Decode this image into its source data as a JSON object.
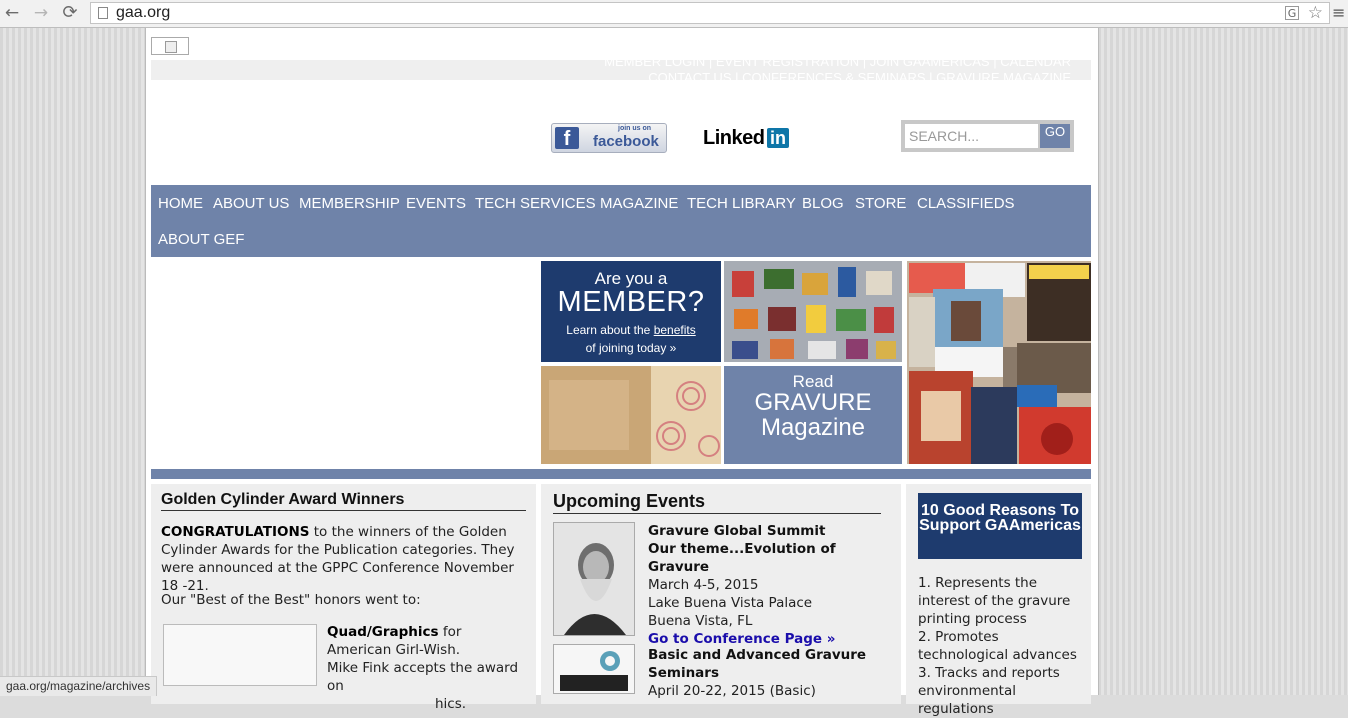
{
  "browser": {
    "url": "gaa.org",
    "back_icon": "←",
    "forward_icon": "→",
    "reload_icon": "⟳",
    "star_icon": "☆",
    "menu_icon": "≡",
    "translate_icon": "G"
  },
  "header": {
    "top_links": "MEMBER LOGIN | EVENT REGISTRATION | JOIN GAAMERICAS | CALENDAR",
    "top_links2": "CONTACT US | CONFERENCES & SEMINARS | GRAVURE MAGAZINE",
    "facebook_small": "join us on",
    "facebook_big": "facebook",
    "facebook_f": "f",
    "linkedin_text": "Linked",
    "linkedin_in": "in",
    "search_placeholder": "SEARCH...",
    "search_go": "GO"
  },
  "nav": {
    "items": [
      "HOME",
      "ABOUT US",
      "MEMBERSHIP",
      "EVENTS",
      "TECH SERVICES",
      "MAGAZINE",
      "TECH LIBRARY",
      "BLOG",
      "STORE",
      "CLASSIFIEDS",
      "ABOUT GEF"
    ]
  },
  "banners": {
    "member_line1": "Are you a",
    "member_line2": "MEMBER?",
    "member_line3a": "Learn about the ",
    "member_link": "benefits",
    "member_line4": "of joining today »",
    "read_line1": "Read",
    "read_line2": "GRAVURE",
    "read_line3": "Magazine"
  },
  "golden": {
    "title": "Golden Cylinder Award Winners",
    "congrats_bold": "CONGRATULATIONS",
    "congrats_rest": " to the winners of the Golden Cylinder Awards for the Publication categories. They were announced at the GPPC Conference November 18 -21.",
    "best_line": "Our \"Best of the Best\" honors went to:",
    "winner_bold": "Quad/Graphics",
    "winner_rest": " for American Girl-Wish.",
    "winner_line2": "Mike Fink accepts the award on",
    "winner_line3": "hics."
  },
  "events": {
    "title": "Upcoming Events",
    "e1_title": "Gravure Global Summit",
    "e1_theme": "Our theme...Evolution of Gravure",
    "e1_date": "March 4-5, 2015",
    "e1_venue": "Lake Buena Vista Palace",
    "e1_city": "Buena Vista, FL",
    "e1_link": "Go to Conference Page »",
    "e2_title": "Basic and Advanced Gravure Seminars",
    "e2_date": "April 20-22, 2015 (Basic)"
  },
  "reasons": {
    "box_title": "10 Good Reasons To Support GAAmericas",
    "r1": "1. Represents the interest of the gravure printing process",
    "r2": "2. Promotes technological advances",
    "r3": "3. Tracks and reports environmental regulations"
  },
  "status_bar": "gaa.org/magazine/archives"
}
